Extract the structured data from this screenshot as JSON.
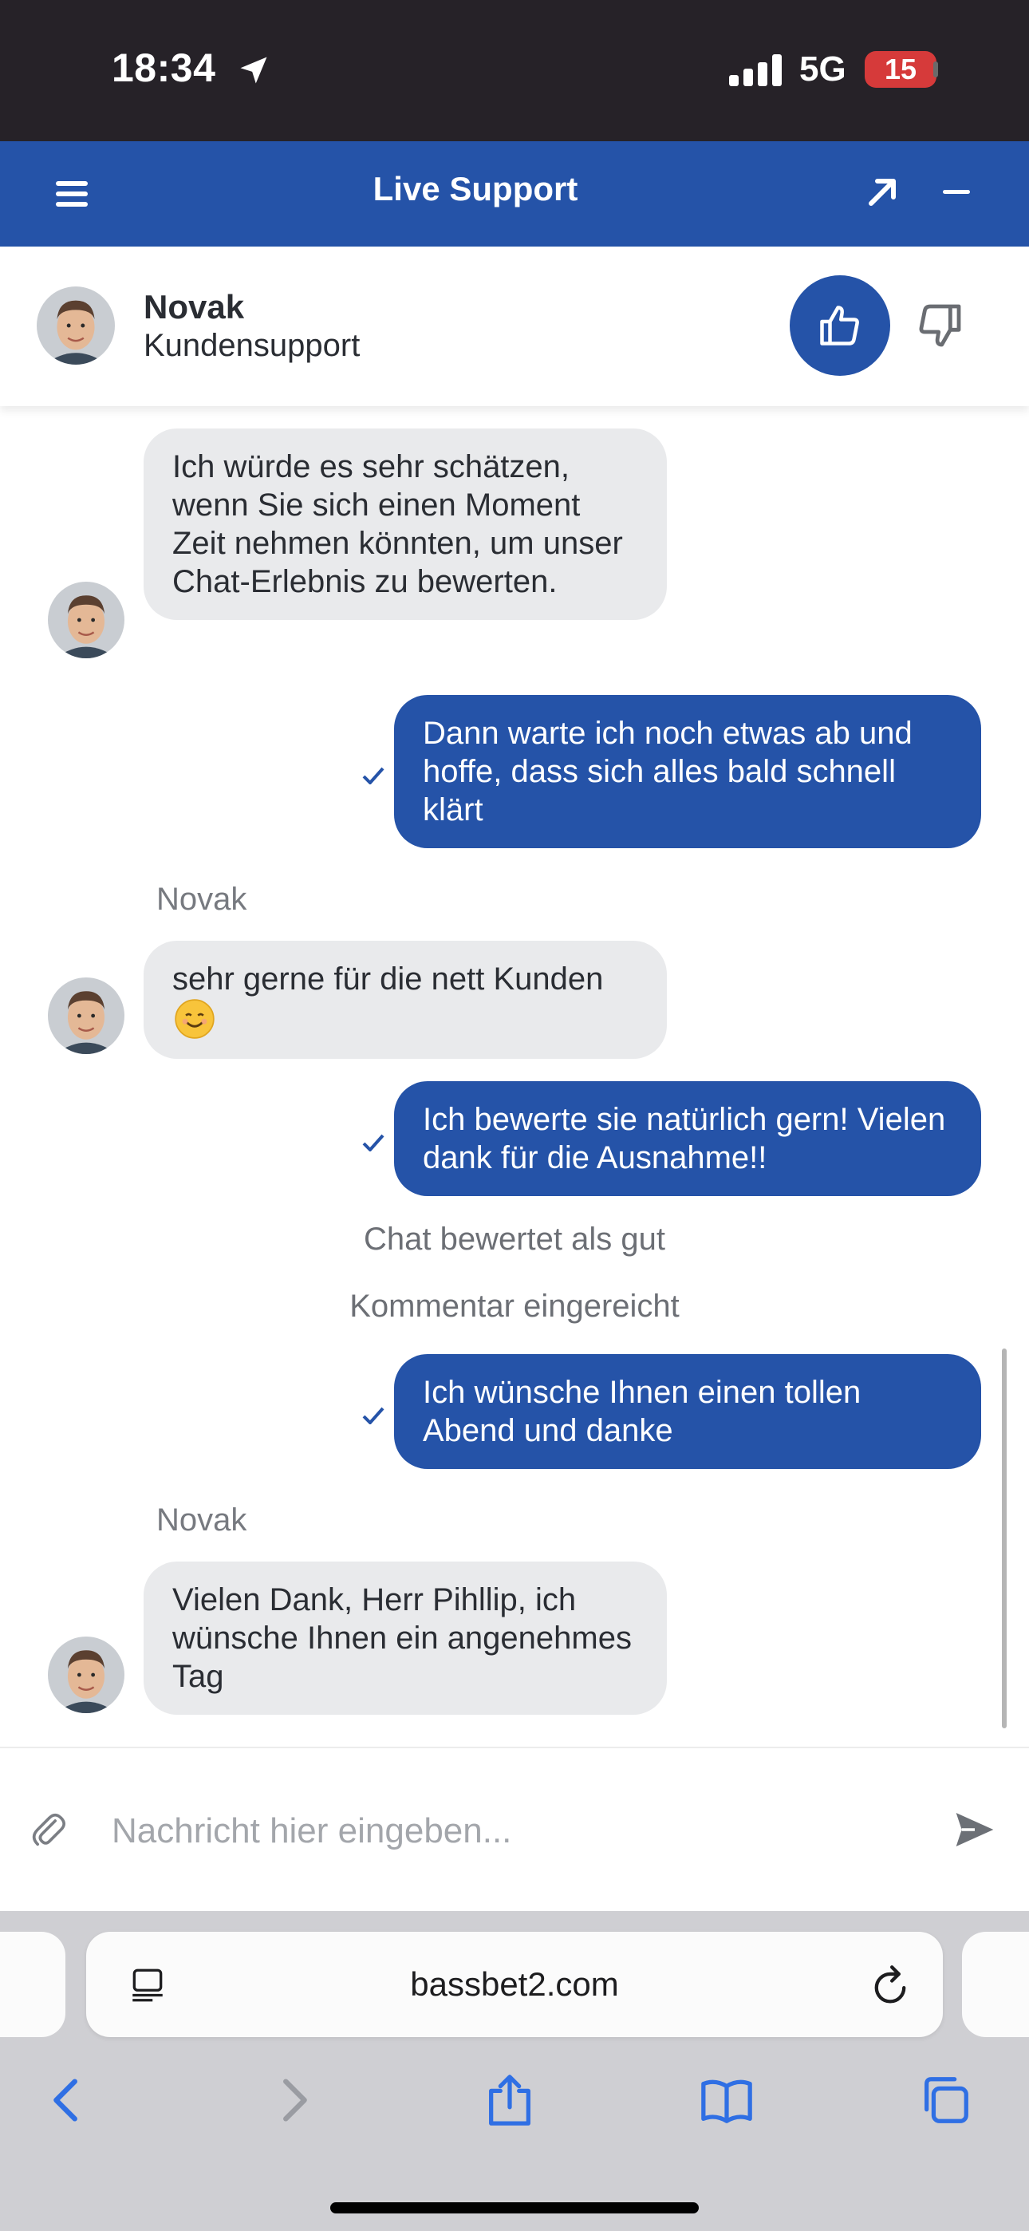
{
  "status_bar": {
    "time": "18:34",
    "network": "5G",
    "battery": "15"
  },
  "header": {
    "title": "Live Support"
  },
  "agent": {
    "name": "Novak",
    "role": "Kundensupport"
  },
  "messages": [
    {
      "type": "in",
      "text": "Ich würde es sehr schätzen, wenn Sie sich einen Moment Zeit nehmen könnten, um unser Chat-Erlebnis zu bewerten."
    },
    {
      "type": "out",
      "text": "Dann warte ich noch etwas ab und hoffe, dass sich alles bald schnell klärt"
    },
    {
      "type": "sender",
      "text": "Novak"
    },
    {
      "type": "in",
      "text": "sehr gerne für die nett Kunden"
    },
    {
      "type": "out",
      "text": "Ich bewerte sie natürlich gern! Vielen dank für die Ausnahme!!"
    },
    {
      "type": "system",
      "text": "Chat bewertet als gut"
    },
    {
      "type": "system",
      "text": "Kommentar eingereicht"
    },
    {
      "type": "out",
      "text": "Ich wünsche Ihnen einen tollen Abend und danke"
    },
    {
      "type": "sender",
      "text": "Novak"
    },
    {
      "type": "in",
      "text": "Vielen Dank, Herr Pihllip, ich wünsche Ihnen ein angenehmes Tag"
    }
  ],
  "composer": {
    "placeholder": "Nachricht hier eingeben..."
  },
  "browser": {
    "url": "bassbet2.com"
  },
  "colors": {
    "brand": "#2553a8",
    "incoming_bubble": "#e9eaec",
    "status_bar": "#262228",
    "battery_low": "#d63a3a"
  }
}
